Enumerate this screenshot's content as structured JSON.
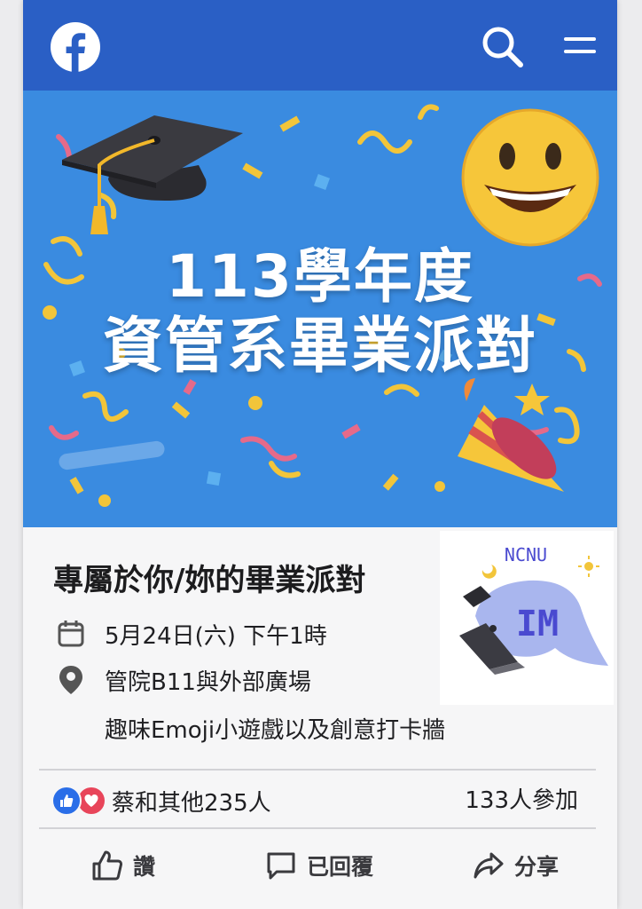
{
  "colors": {
    "header_bg": "#2a5fc5",
    "banner_bg": "#3a8be0",
    "like_blue": "#2a6ee8",
    "love_red": "#e8455a"
  },
  "header": {
    "logo_icon": "facebook-logo-icon",
    "search_icon": "search-icon",
    "menu_icon": "hamburger-menu-icon"
  },
  "banner": {
    "line1": "113學年度",
    "line2": "資管系畢業派對"
  },
  "event": {
    "title": "專屬於你/妳的畢業派對",
    "date": "5月24日(六) 下午1時",
    "location": "管院B11與外部廣場",
    "activity": "趣味Emoji小遊戲以及創意打卡牆"
  },
  "logo": {
    "top_text": "NCNU",
    "badge_text": "IM"
  },
  "social": {
    "reactions_text": "蔡和其他235人",
    "attending_text": "133人參加"
  },
  "actions": {
    "like_label": "讚",
    "reply_label": "已回覆",
    "share_label": "分享"
  }
}
